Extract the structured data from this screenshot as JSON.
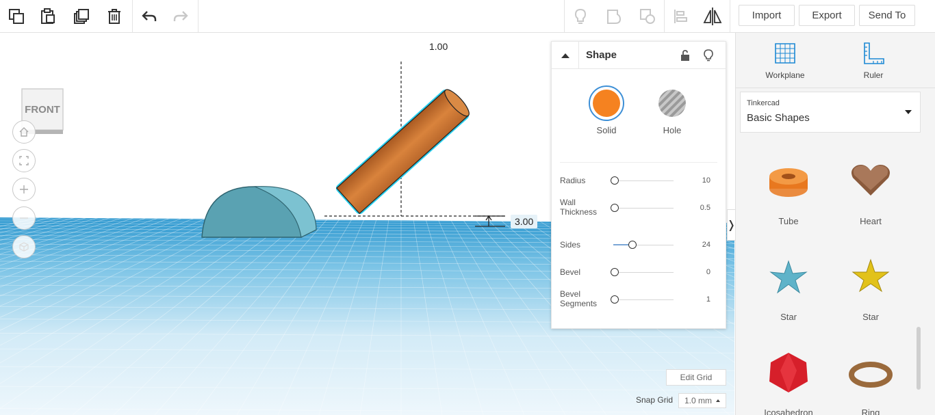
{
  "toolbar": {
    "import_label": "Import",
    "export_label": "Export",
    "send_to_label": "Send To"
  },
  "viewport": {
    "view_cube_label": "FRONT",
    "dim_top": "1.00",
    "dim_right": "3.00",
    "edit_grid_label": "Edit Grid",
    "snap_grid_label": "Snap Grid",
    "snap_grid_value": "1.0 mm"
  },
  "inspector": {
    "title": "Shape",
    "solid_label": "Solid",
    "hole_label": "Hole",
    "solid_color": "#f58220",
    "properties": [
      {
        "label": "Radius",
        "value": "10",
        "fraction": 0.0
      },
      {
        "label": "Wall Thickness",
        "value": "0.5",
        "fraction": 0.0
      },
      {
        "label": "Sides",
        "value": "24",
        "fraction": 0.3
      },
      {
        "label": "Bevel",
        "value": "0",
        "fraction": 0.0
      },
      {
        "label": "Bevel Segments",
        "value": "1",
        "fraction": 0.0
      }
    ]
  },
  "right_panel": {
    "workplane_label": "Workplane",
    "ruler_label": "Ruler",
    "library_provider": "Tinkercad",
    "library_name": "Basic Shapes",
    "shapes": [
      {
        "label": "Tube",
        "color": "#e8781f"
      },
      {
        "label": "Heart",
        "color": "#8a5a3c"
      },
      {
        "label": "Star",
        "color": "#5fb3c9"
      },
      {
        "label": "Star",
        "color": "#e2c21a"
      },
      {
        "label": "Icosahedron",
        "color": "#d61f2a"
      },
      {
        "label": "Ring",
        "color": "#9a6a3c"
      }
    ]
  },
  "colors": {
    "accent": "#1b95e0",
    "grid_blue": "#2d9fd3",
    "cylinder": "#c9732e",
    "half_cylinder": "#5fa9b8"
  }
}
